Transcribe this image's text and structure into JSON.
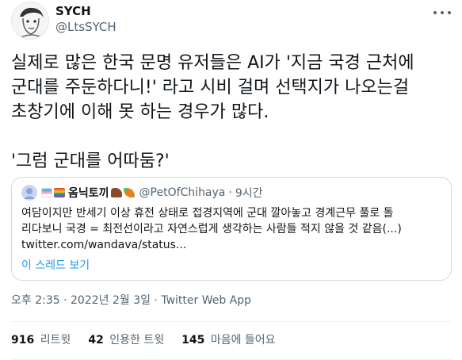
{
  "author": {
    "display_name": "SYCH",
    "handle": "@LtsSYCH"
  },
  "tweet_text": "실제로 많은 한국 문명 유저들은 AI가 '지금 국경 근처에\n군대를 주둔하다니!' 라고 시비 걸며 선택지가 나오는걸\n초창기에 이해 못 하는 경우가 많다.\n\n'그럼 군대를 어따둠?'",
  "quoted_tweet": {
    "display_name": "옴닉토끼",
    "handle": "@PetOfChihaya",
    "separator": "·",
    "time": "9시간",
    "text": "여담이지만 반세기 이상 휴전 상태로 접경지역에 군대 깔아놓고 경계근무 풀로 돌\n리다보니 국경 = 최전선이라고 자연스럽게 생각하는 사람들 적지 않을 것 같음(...)\ntwitter.com/wandava/status...",
    "thread_link": "이 스레드 보기",
    "name_emoji_colors": [
      "#6fa8dc",
      "#f4a6c8",
      "#e74c3c",
      "#8a4b2b",
      "#e67e22"
    ]
  },
  "meta": {
    "timestamp": "오후 2:35 · 2022년 2월 3일 · Twitter Web App"
  },
  "stats": {
    "retweets_count": "916",
    "retweets_label": "리트윗",
    "quotes_count": "42",
    "quotes_label": "인용한 트윗",
    "likes_count": "145",
    "likes_label": "마음에 들어요"
  },
  "colors": {
    "link_blue": "#1d9bf0",
    "secondary_text": "#536471",
    "border": "#cfd9de"
  }
}
